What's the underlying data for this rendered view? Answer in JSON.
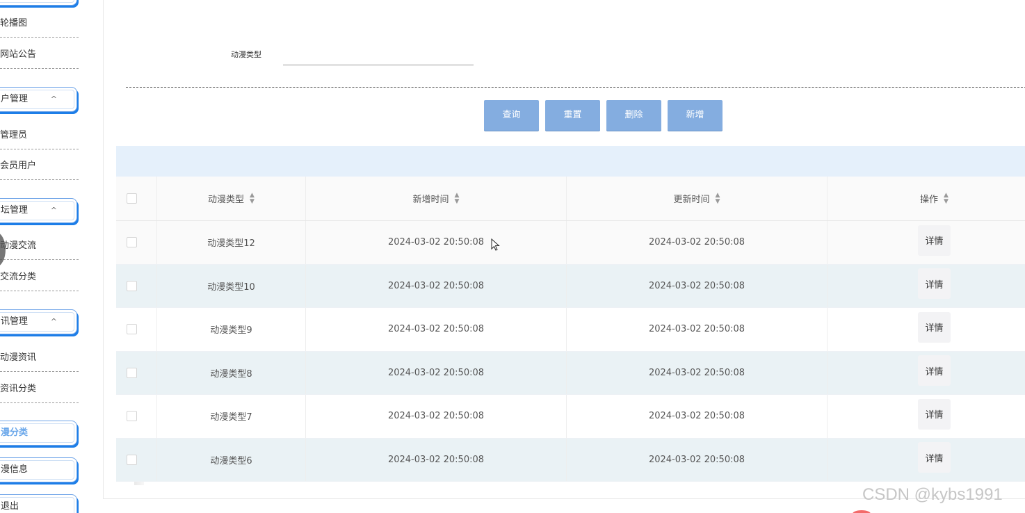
{
  "sidebar": {
    "items": [
      {
        "kind": "sub",
        "label": "轮播图"
      },
      {
        "kind": "sub",
        "label": "网站公告"
      },
      {
        "kind": "group",
        "label": "户管理",
        "caret": "^"
      },
      {
        "kind": "sub",
        "label": "管理员"
      },
      {
        "kind": "sub",
        "label": "会员用户"
      },
      {
        "kind": "group",
        "label": "坛管理",
        "caret": "^"
      },
      {
        "kind": "sub",
        "label": "动漫交流"
      },
      {
        "kind": "sub",
        "label": "交流分类"
      },
      {
        "kind": "group",
        "label": "讯管理",
        "caret": "^"
      },
      {
        "kind": "sub",
        "label": "动漫资讯"
      },
      {
        "kind": "sub",
        "label": "资讯分类"
      },
      {
        "kind": "group",
        "label": "漫分类",
        "active": true
      },
      {
        "kind": "group",
        "label": "漫信息"
      },
      {
        "kind": "group",
        "label": "退出"
      }
    ]
  },
  "search": {
    "label": "动漫类型",
    "value": "",
    "placeholder": ""
  },
  "buttons": {
    "query": "查询",
    "reset": "重置",
    "delete": "删除",
    "add": "新增"
  },
  "table": {
    "headers": [
      "动漫类型",
      "新增时间",
      "更新时间",
      "操作"
    ],
    "rows": [
      {
        "type": "动漫类型12",
        "added": "2024-03-02 20:50:08",
        "updated": "2024-03-02 20:50:08",
        "action": "详情"
      },
      {
        "type": "动漫类型10",
        "added": "2024-03-02 20:50:08",
        "updated": "2024-03-02 20:50:08",
        "action": "详情"
      },
      {
        "type": "动漫类型9",
        "added": "2024-03-02 20:50:08",
        "updated": "2024-03-02 20:50:08",
        "action": "详情"
      },
      {
        "type": "动漫类型8",
        "added": "2024-03-02 20:50:08",
        "updated": "2024-03-02 20:50:08",
        "action": "详情"
      },
      {
        "type": "动漫类型7",
        "added": "2024-03-02 20:50:08",
        "updated": "2024-03-02 20:50:08",
        "action": "详情"
      },
      {
        "type": "动漫类型6",
        "added": "2024-03-02 20:50:08",
        "updated": "2024-03-02 20:50:08",
        "action": "详情"
      }
    ]
  },
  "toolbar_glyph": "〒",
  "watermark": "CSDN @kybs1991",
  "colors": {
    "button": "#84ade0",
    "bar": "#e5f0fb",
    "row_alt": "#eaf2f5",
    "accent": "#1d7ee8"
  }
}
